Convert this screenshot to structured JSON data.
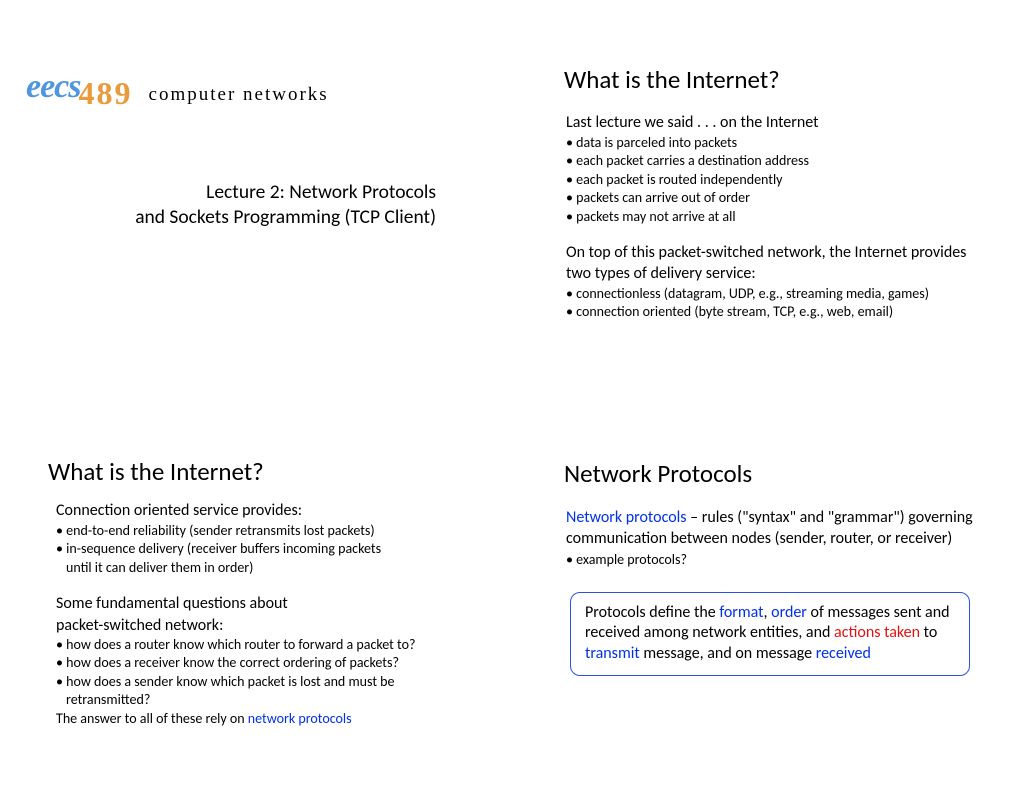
{
  "s1": {
    "eecs": "eecs",
    "num": "489",
    "course": "computer networks",
    "line1": "Lecture 2: Network Protocols",
    "line2": "and Sockets Programming (TCP Client)"
  },
  "s2": {
    "heading": "What is the Internet?",
    "intro": "Last lecture we said . . . on the Internet",
    "b1": "• data is parceled into packets",
    "b2": "• each packet carries a destination address",
    "b3": "• each packet is routed independently",
    "b4": "• packets can arrive out of order",
    "b5": "• packets may not arrive at all",
    "para1": "On top of this packet-switched network, the Internet provides two types of delivery service:",
    "d1": "• connectionless (datagram, UDP, e.g., streaming media, games)",
    "d2": "• connection oriented (byte stream, TCP, e.g., web, email)"
  },
  "s3": {
    "heading": "What is the Internet?",
    "intro": "Connection oriented service provides:",
    "c1": "• end-to-end reliability (sender retransmits lost packets)",
    "c2": "• in-sequence delivery (receiver buffers incoming packets",
    "c2b": "until it can deliver them in order)",
    "q_intro1": "Some fundamental questions about",
    "q_intro2": "packet-switched network:",
    "q1": "• how does a router know which router to forward a packet to?",
    "q2": "• how does a receiver know the correct ordering of packets?",
    "q3": "• how does a sender know which packet is lost and must be",
    "q3b": "retransmitted?",
    "ans_pre": "The answer to all of these rely on ",
    "ans_link": "network protocols"
  },
  "s4": {
    "heading": "Network Protocols",
    "t_blue": "Network protocols",
    "t_rest": " – rules (\"syntax\" and \"grammar\") governing communication between nodes (sender, router, or receiver)",
    "ex": "• example protocols?",
    "box": {
      "p1": "Protocols define the ",
      "format": "format",
      "p2": ", ",
      "order": "order",
      "p3": " of messages sent and received among network entities, and ",
      "actions": "actions taken",
      "p4": " to ",
      "transmit": "transmit",
      "p5": " message, and on message ",
      "received": "received"
    }
  }
}
